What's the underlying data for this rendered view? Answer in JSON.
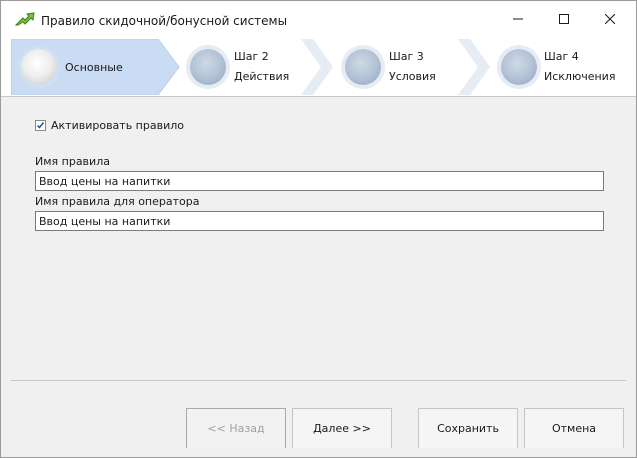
{
  "window": {
    "title": "Правило скидочной/бонусной системы",
    "accent": "#c9dcf3"
  },
  "icons": {
    "app": "green-arrow-icon",
    "minimize": "minimize-icon",
    "maximize": "maximize-icon",
    "close": "close-icon",
    "check": "check-icon"
  },
  "wizard": {
    "steps": [
      {
        "step": "",
        "label": "Основные",
        "active": true
      },
      {
        "step": "Шаг 2",
        "label": "Действия",
        "active": false
      },
      {
        "step": "Шаг 3",
        "label": "Условия",
        "active": false
      },
      {
        "step": "Шаг 4",
        "label": "Исключения",
        "active": false
      }
    ]
  },
  "form": {
    "activate_label": "Активировать правило",
    "activate_checked": true,
    "rule_name_label": "Имя правила",
    "rule_name_value": "Ввод цены на напитки",
    "operator_name_label": "Имя правила для оператора",
    "operator_name_value": "Ввод цены на напитки"
  },
  "buttons": {
    "back": "<< Назад",
    "next": "Далее >>",
    "save": "Сохранить",
    "cancel": "Отмена"
  }
}
